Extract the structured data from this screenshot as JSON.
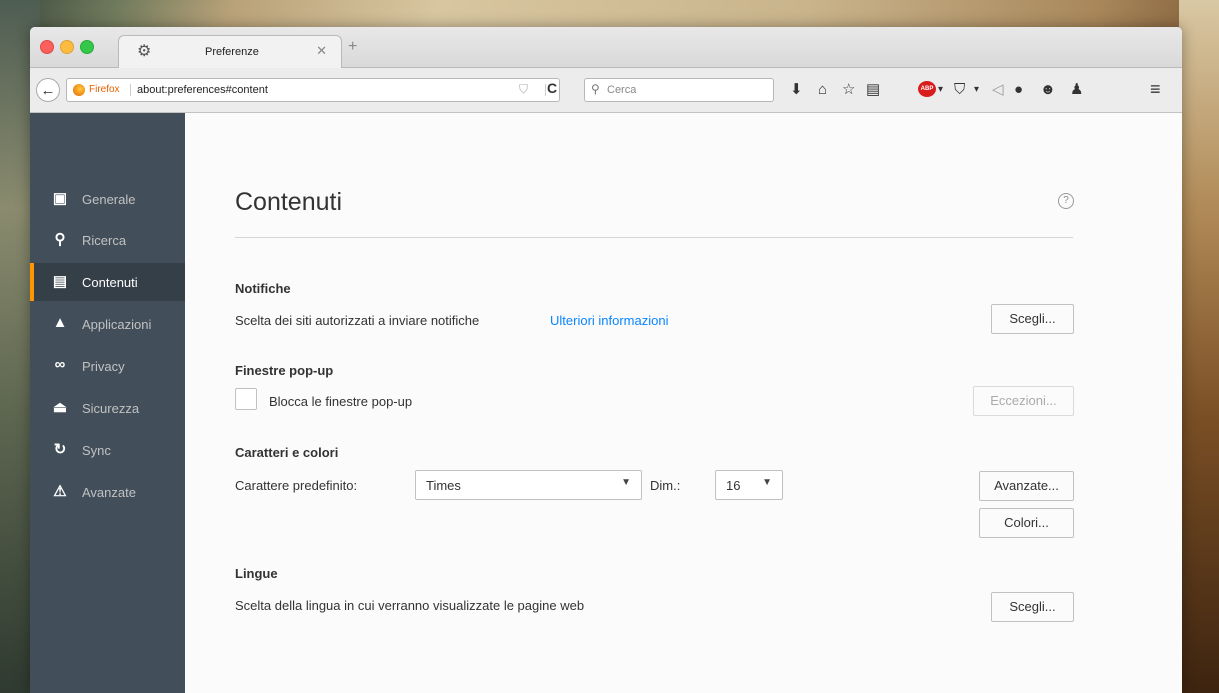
{
  "tab": {
    "title": "Preferenze"
  },
  "navbar": {
    "identity": "Firefox",
    "url": "about:preferences#content",
    "search_placeholder": "Cerca"
  },
  "sidebar": {
    "items": [
      {
        "label": "Generale",
        "icon": "general-icon"
      },
      {
        "label": "Ricerca",
        "icon": "search-icon"
      },
      {
        "label": "Contenuti",
        "icon": "content-icon",
        "active": true
      },
      {
        "label": "Applicazioni",
        "icon": "applications-icon"
      },
      {
        "label": "Privacy",
        "icon": "privacy-mask-icon"
      },
      {
        "label": "Sicurezza",
        "icon": "lock-icon"
      },
      {
        "label": "Sync",
        "icon": "sync-icon"
      },
      {
        "label": "Avanzate",
        "icon": "advanced-icon"
      }
    ]
  },
  "content": {
    "title": "Contenuti",
    "notifications": {
      "heading": "Notifiche",
      "text": "Scelta dei siti autorizzati a inviare notifiche",
      "link": "Ulteriori informazioni",
      "button": "Scegli..."
    },
    "popups": {
      "heading": "Finestre pop-up",
      "checkbox_label": "Blocca le finestre pop-up",
      "checked": false,
      "button": "Eccezioni..."
    },
    "fonts": {
      "heading": "Caratteri e colori",
      "default_label": "Carattere predefinito:",
      "font_value": "Times",
      "size_label": "Dim.:",
      "size_value": "16",
      "advanced_button": "Avanzate...",
      "colors_button": "Colori..."
    },
    "languages": {
      "heading": "Lingue",
      "text": "Scelta della lingua in cui verranno visualizzate le pagine web",
      "button": "Scegli..."
    }
  },
  "colors": {
    "sidebar_bg": "#424f5a",
    "sidebar_active": "#343f48",
    "accent": "#ff9500",
    "link": "#0a84ff"
  }
}
